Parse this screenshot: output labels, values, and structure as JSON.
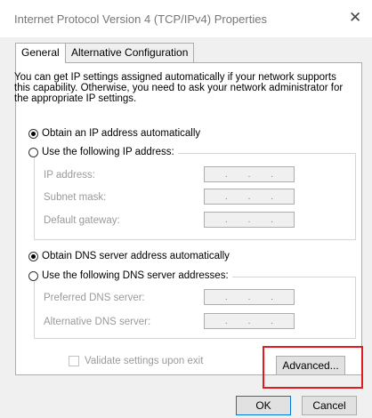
{
  "window": {
    "title": "Internet Protocol Version 4 (TCP/IPv4) Properties",
    "close_glyph": "✕"
  },
  "tabs": [
    {
      "label": "General",
      "active": true
    },
    {
      "label": "Alternative Configuration",
      "active": false
    }
  ],
  "intro_text": "You can get IP settings assigned automatically if your network supports this capability. Otherwise, you need to ask your network administrator for the appropriate IP settings.",
  "ip_section": {
    "obtain_auto_label": "Obtain an IP address automatically",
    "use_following_label": "Use the following IP address:",
    "selected": "obtain_auto",
    "fields": [
      {
        "label": "IP address:",
        "value": ". . ."
      },
      {
        "label": "Subnet mask:",
        "value": ". . ."
      },
      {
        "label": "Default gateway:",
        "value": ". . ."
      }
    ]
  },
  "dns_section": {
    "obtain_auto_label": "Obtain DNS server address automatically",
    "use_following_label": "Use the following DNS server addresses:",
    "selected": "obtain_auto",
    "fields": [
      {
        "label": "Preferred DNS server:",
        "value": ". . ."
      },
      {
        "label": "Alternative DNS server:",
        "value": ". . ."
      }
    ]
  },
  "validate_label": "Validate settings upon exit",
  "validate_checked": false,
  "buttons": {
    "advanced": "Advanced...",
    "ok": "OK",
    "cancel": "Cancel"
  },
  "colors": {
    "highlight": "#e01b22",
    "disabled_text": "#9a9a9a"
  }
}
